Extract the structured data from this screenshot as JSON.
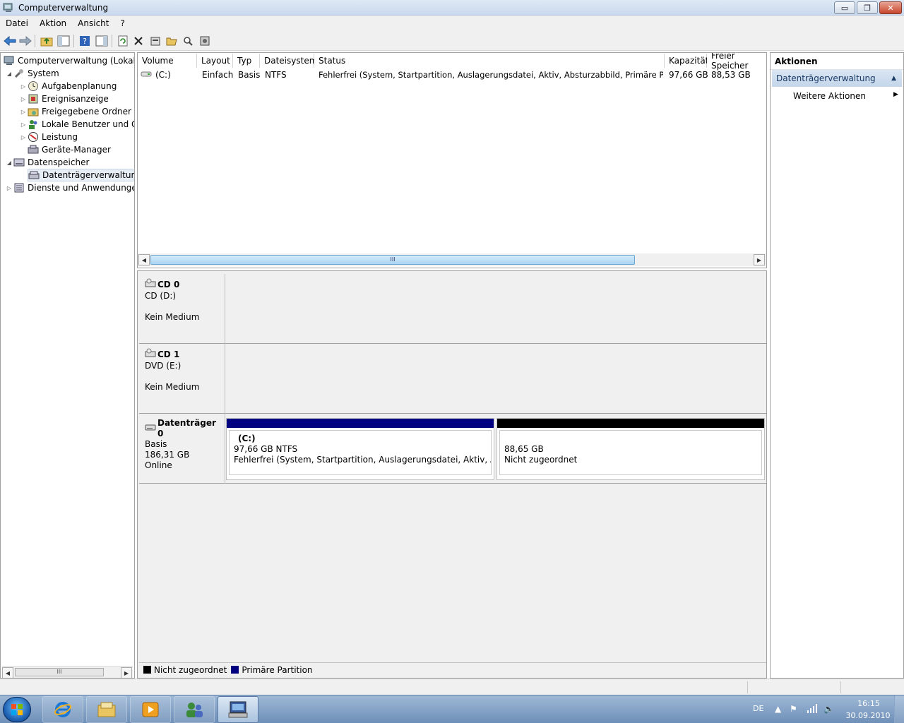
{
  "window": {
    "title": "Computerverwaltung",
    "controls": {
      "minimize": "▭",
      "maximize": "❐",
      "close": "✕"
    }
  },
  "menu": [
    "Datei",
    "Aktion",
    "Ansicht",
    "?"
  ],
  "toolbar": {
    "icons": [
      "back-icon",
      "forward-icon",
      "up-folder-icon",
      "show-hide-tree-icon",
      "help-icon",
      "show-hide-action-icon",
      "refresh-icon",
      "delete-icon",
      "properties-icon",
      "open-icon",
      "search-icon",
      "settings-icon"
    ]
  },
  "tree": {
    "root": "Computerverwaltung (Lokal)",
    "system": "System",
    "aufgabenplanung": "Aufgabenplanung",
    "ereignisanzeige": "Ereignisanzeige",
    "freigegebene_ordner": "Freigegebene Ordner",
    "lokale_benutzer": "Lokale Benutzer und Gruppen",
    "leistung": "Leistung",
    "geraete_manager": "Geräte-Manager",
    "datenspeicher": "Datenspeicher",
    "datentraegerverwaltung": "Datenträgerverwaltung",
    "dienste": "Dienste und Anwendungen",
    "scroll_grip": "III"
  },
  "volume_list": {
    "columns": [
      "Volume",
      "Layout",
      "Typ",
      "Dateisystem",
      "Status",
      "Kapazität",
      "Freier Speicher"
    ],
    "rows": [
      {
        "volume": "(C:)",
        "layout": "Einfach",
        "typ": "Basis",
        "dateisystem": "NTFS",
        "status": "Fehlerfrei (System, Startpartition, Auslagerungsdatei, Aktiv, Absturzabbild, Primäre Partition)",
        "kapazitaet": "97,66 GB",
        "frei": "88,53 GB"
      }
    ],
    "scroll_grip": "III"
  },
  "disks": {
    "cd0": {
      "name": "CD 0",
      "line1": "CD (D:)",
      "line2": "Kein Medium"
    },
    "cd1": {
      "name": "CD 1",
      "line1": "DVD (E:)",
      "line2": "Kein Medium"
    },
    "disk0": {
      "name": "Datenträger 0",
      "line1": "Basis",
      "line2": "186,31 GB",
      "line3": "Online",
      "partitions": [
        {
          "label": "(C:)",
          "size": "97,66 GB NTFS",
          "status": "Fehlerfrei (System, Startpartition, Auslagerungsdatei, Aktiv, Absturzabbild, Primäre Partition)",
          "bar_color": "#000080"
        },
        {
          "label": "",
          "size": "88,65 GB",
          "status": "Nicht zugeordnet",
          "bar_color": "#000000"
        }
      ]
    }
  },
  "legend": [
    {
      "label": "Nicht zugeordnet",
      "color": "#000000"
    },
    {
      "label": "Primäre Partition",
      "color": "#000080"
    }
  ],
  "actions": {
    "title": "Aktionen",
    "section": "Datenträgerverwaltung",
    "more": "Weitere Aktionen"
  },
  "taskbar": {
    "apps": [
      "internet-explorer-icon",
      "explorer-icon",
      "media-player-icon",
      "users-icon",
      "computer-management-icon"
    ],
    "lang": "DE",
    "time": "16:15",
    "date": "30.09.2010"
  }
}
